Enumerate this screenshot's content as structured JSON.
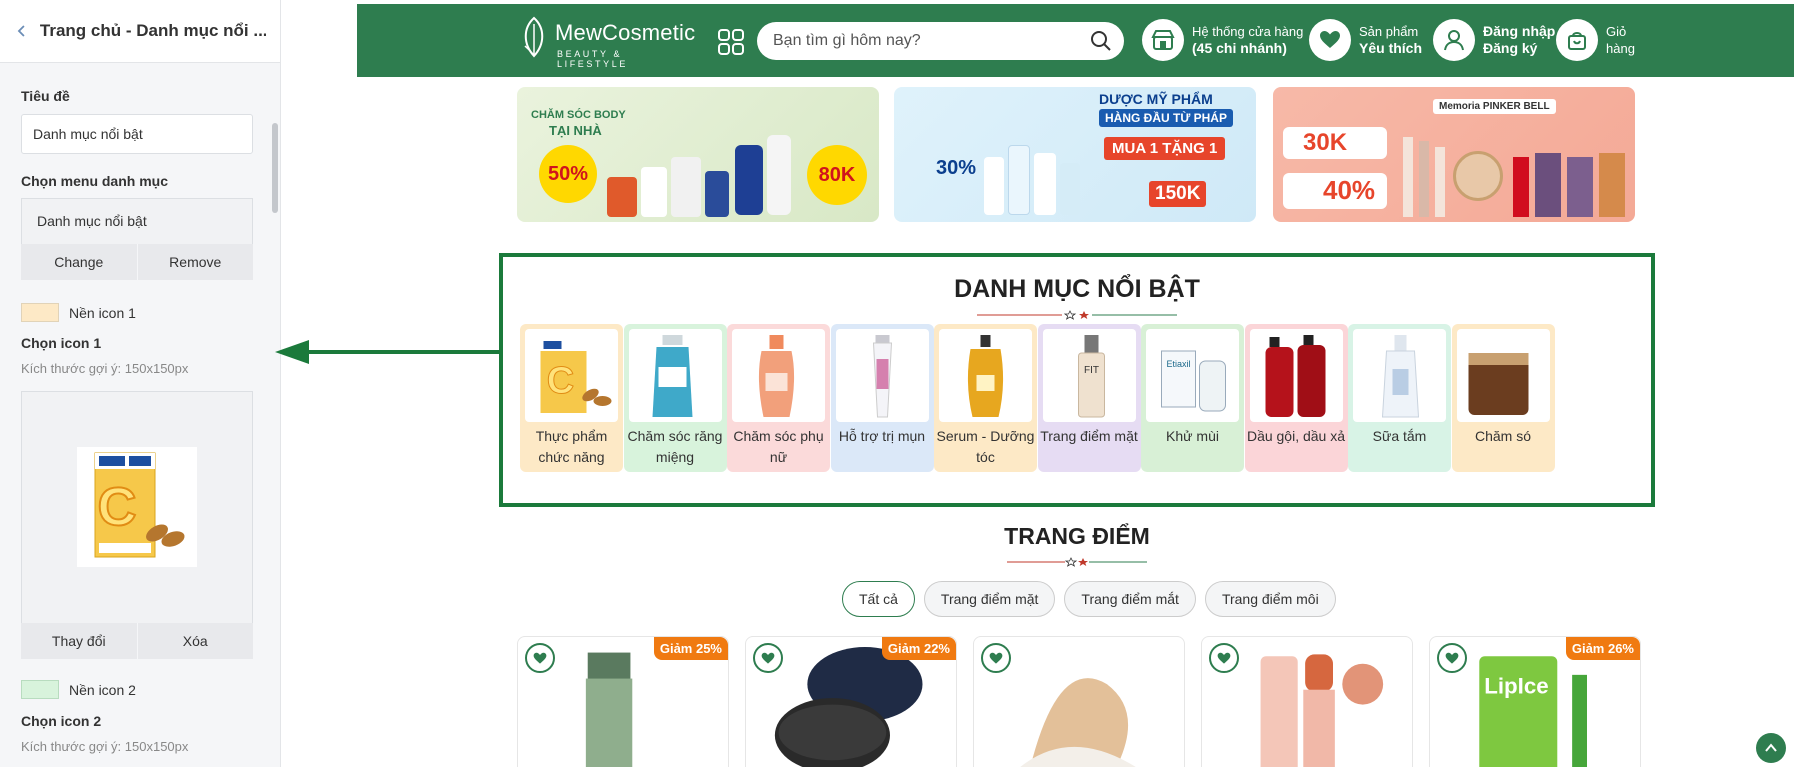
{
  "editor": {
    "header_title": "Trang chủ - Danh mục nổi ...",
    "title_label": "Tiêu đề",
    "title_value": "Danh mục nổi bật",
    "menu_label": "Chọn menu danh mục",
    "menu_value": "Danh mục nổi bật",
    "change_label": "Change",
    "remove_label": "Remove",
    "bg_icon1_label": "Nền icon 1",
    "bg_icon1_color": "#fde9c6",
    "choose_icon1_label": "Chọn icon 1",
    "size_hint_1": "Kích thước gợi ý: 150x150px",
    "replace_label": "Thay đổi",
    "delete_label": "Xóa",
    "bg_icon2_label": "Nền icon 2",
    "bg_icon2_color": "#d8f3dc",
    "choose_icon2_label": "Chọn icon 2",
    "size_hint_2": "Kích thước gợi ý: 150x150px"
  },
  "shop": {
    "brand": "MewCosmetic",
    "tagline": "BEAUTY & LIFESTYLE",
    "search_placeholder": "Bạn tìm gì hôm nay?",
    "stores_line1": "Hệ thống cửa hàng",
    "stores_line2": "(45 chi nhánh)",
    "fav_line1": "Sản phẩm",
    "fav_line2": "Yêu thích",
    "login_line1": "Đăng nhập",
    "login_line2": "Đăng ký",
    "cart_line1": "Giỏ",
    "cart_line2": "hàng",
    "primary_color": "#2e7d4f"
  },
  "banners": {
    "b1_title1": "CHĂM SÓC BODY",
    "b1_title2": "TẠI NHÀ",
    "b1_discount": "50%",
    "b1_gift": "80K",
    "b2_title1": "DƯỢC MỸ PHẨM",
    "b2_title2": "HÀNG ĐẦU TỪ PHÁP",
    "b2_promo": "MUA 1 TẶNG 1",
    "b2_discount": "30%",
    "b2_gift": "150K",
    "b3_gift": "30K",
    "b3_discount": "40%",
    "b3_brands": "Memoria PINKER BELL"
  },
  "featured": {
    "title": "DANH MỤC NỔI BẬT",
    "categories": [
      {
        "label": "Thực phẩm chức năng",
        "bg": "#fde9c6"
      },
      {
        "label": "Chăm sóc răng miệng",
        "bg": "#d8f3dc"
      },
      {
        "label": "Chăm sóc phụ nữ",
        "bg": "#fbdada"
      },
      {
        "label": "Hỗ trợ trị mụn",
        "bg": "#dbe8f8"
      },
      {
        "label": "Serum - Dưỡng tóc",
        "bg": "#fde9c6"
      },
      {
        "label": "Trang điểm mặt",
        "bg": "#e6dcf3"
      },
      {
        "label": "Khử mùi",
        "bg": "#d8f0d6"
      },
      {
        "label": "Dầu gội, dầu xả",
        "bg": "#fbd5d8"
      },
      {
        "label": "Sữa tắm",
        "bg": "#d8f3e6"
      },
      {
        "label": "Chăm só",
        "bg": "#fde9c6"
      }
    ]
  },
  "makeup": {
    "title": "TRANG ĐIỂM",
    "filters": [
      "Tất cả",
      "Trang điểm mặt",
      "Trang điểm mắt",
      "Trang điểm môi"
    ],
    "products": [
      {
        "badge": "Giảm 25%"
      },
      {
        "badge": "Giảm 22%"
      },
      {
        "badge": ""
      },
      {
        "badge": ""
      },
      {
        "badge": "Giảm 26%"
      }
    ]
  }
}
